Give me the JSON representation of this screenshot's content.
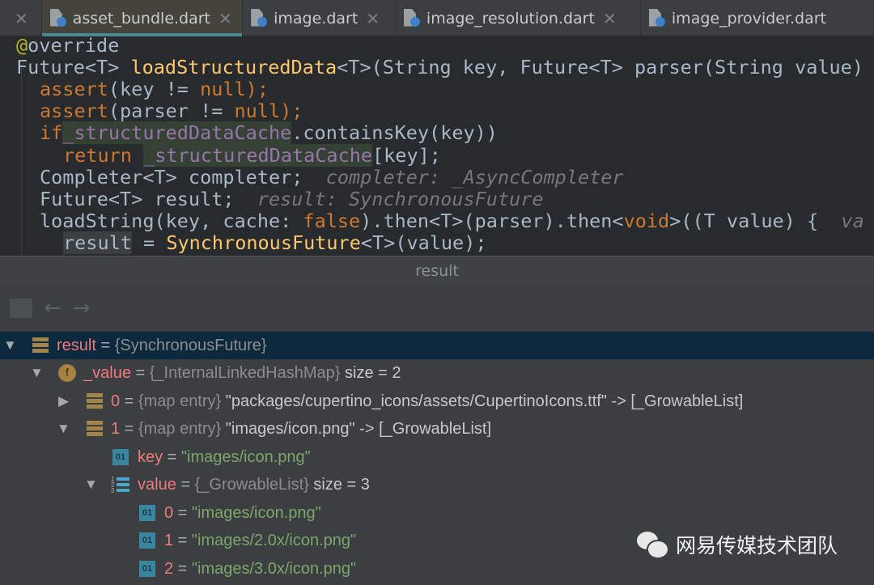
{
  "tabs": [
    {
      "label": "asset_bundle.dart",
      "active": true
    },
    {
      "label": "image.dart"
    },
    {
      "label": "image_resolution.dart"
    },
    {
      "label": "image_provider.dart"
    }
  ],
  "code": {
    "l1": "@override",
    "l2a": "Future<T> ",
    "l2b": "loadStructuredData",
    "l2c": "<T>(String key, Future<T> parser(String value)",
    "l3a": "assert",
    "l3b": "(key != ",
    "l3c": "null",
    "l3d": ");",
    "l4a": "assert",
    "l4b": "(parser != ",
    "l4c": "null",
    "l4d": ");",
    "l5a": "if",
    " l5b": " (",
    "l5c": "_structuredDataCache",
    "l5d": ".containsKey(key))",
    "l6a": "return ",
    "l6b": "_structuredDataCache",
    "l6c": "[key];",
    "l7a": "Completer<T> completer;",
    "l7h": "completer: _AsyncCompleter",
    "l8a": "Future<T> result;",
    "l8h": "result: SynchronousFuture",
    "l9a": "loadString(key, cache: ",
    "l9b": "false",
    "l9c": ").then<T>(parser).then<",
    "l9d": "void",
    "l9e": ">((T value) {",
    "l9h": "va",
    "l10a": "result",
    "l10b": " = ",
    "l10c": "SynchronousFuture",
    "l10d": "<T>(value);"
  },
  "panel": {
    "title": "result"
  },
  "tree": [
    {
      "name": "result",
      "type": "{SynchronousFuture}",
      "extra": ""
    },
    {
      "name": "_value",
      "type": "{_InternalLinkedHashMap}",
      "extra": "size = 2"
    },
    {
      "name": "0",
      "type": "{map entry}",
      "extra": "\"packages/cupertino_icons/assets/CupertinoIcons.ttf\" -> [_GrowableList]"
    },
    {
      "name": "1",
      "type": "{map entry}",
      "extra": "\"images/icon.png\" -> [_GrowableList]"
    },
    {
      "name": "key",
      "value": "\"images/icon.png\""
    },
    {
      "name": "value",
      "type": "{_GrowableList}",
      "extra": "size = 3"
    },
    {
      "name": "0",
      "value": "\"images/icon.png\""
    },
    {
      "name": "1",
      "value": "\"images/2.0x/icon.png\""
    },
    {
      "name": "2",
      "value": "\"images/3.0x/icon.png\""
    }
  ],
  "eq": " = ",
  "watermark": "网易传媒技术团队"
}
